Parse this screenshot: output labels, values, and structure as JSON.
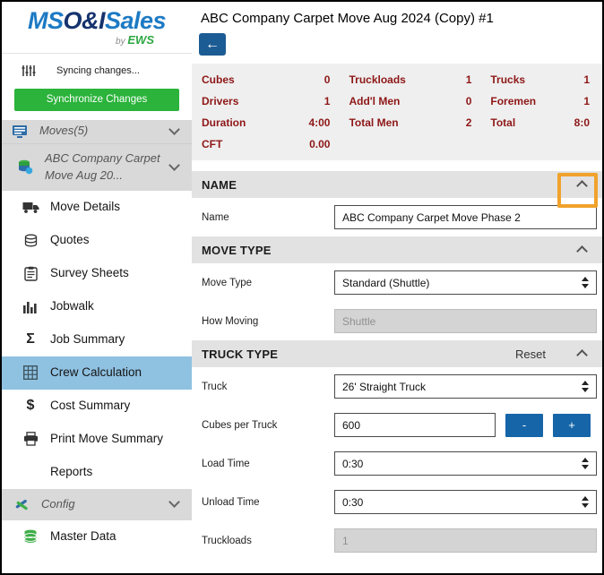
{
  "header": {
    "title": "ABC Company Carpet Move Aug 2024 (Copy) #1"
  },
  "sidebar": {
    "logo": {
      "ms": "MS",
      "oi": "O&I",
      "sales": "Sales",
      "by": "by",
      "ews": "EWS"
    },
    "sync_status": "Syncing changes...",
    "sync_button_label": "Synchronize Changes",
    "items": [
      {
        "label": "Moves(5)",
        "icon": "monitor-icon",
        "style": "group",
        "chevron": "down"
      },
      {
        "label": "ABC Company Carpet Move Aug 20...",
        "icon": "database-icon",
        "style": "subgroup",
        "chevron": "down"
      },
      {
        "label": "Move Details",
        "icon": "truck-icon"
      },
      {
        "label": "Quotes",
        "icon": "coins-icon"
      },
      {
        "label": "Survey Sheets",
        "icon": "clipboard-icon"
      },
      {
        "label": "Jobwalk",
        "icon": "barchart-icon"
      },
      {
        "label": "Job Summary",
        "icon": "sigma-icon"
      },
      {
        "label": "Crew Calculation",
        "icon": "calculator-icon",
        "selected": true
      },
      {
        "label": "Cost Summary",
        "icon": "dollar-icon"
      },
      {
        "label": "Print Move Summary",
        "icon": "printer-icon"
      },
      {
        "label": "Reports",
        "icon": "none"
      },
      {
        "label": "Config",
        "icon": "tools-icon",
        "style": "group-config",
        "chevron": "down"
      },
      {
        "label": "Master Data",
        "icon": "masterdata-icon"
      }
    ]
  },
  "summary": {
    "cells": [
      {
        "label": "Cubes",
        "value": "0"
      },
      {
        "label": "Truckloads",
        "value": "1"
      },
      {
        "label": "Trucks",
        "value": "1"
      },
      {
        "label": "Drivers",
        "value": "1"
      },
      {
        "label": "Add'l Men",
        "value": "0"
      },
      {
        "label": "Foremen",
        "value": "1"
      },
      {
        "label": "Duration",
        "value": "4:00"
      },
      {
        "label": "Total Men",
        "value": "2"
      },
      {
        "label": "Total",
        "value": "8:0"
      },
      {
        "label": "CFT",
        "value": "0.00"
      }
    ]
  },
  "form": {
    "name_section": {
      "title": "NAME"
    },
    "name_field": {
      "label": "Name",
      "value": "ABC Company Carpet Move Phase 2"
    },
    "move_type_section": {
      "title": "MOVE TYPE"
    },
    "move_type_field": {
      "label": "Move Type",
      "value": "Standard (Shuttle)"
    },
    "how_moving_field": {
      "label": "How Moving",
      "value": "Shuttle"
    },
    "truck_type_section": {
      "title": "TRUCK TYPE",
      "reset_label": "Reset"
    },
    "truck_field": {
      "label": "Truck",
      "value": "26' Straight Truck"
    },
    "cubes_per_truck_field": {
      "label": "Cubes per Truck",
      "value": "600",
      "minus_label": "-",
      "plus_label": "+"
    },
    "load_time_field": {
      "label": "Load Time",
      "value": "0:30"
    },
    "unload_time_field": {
      "label": "Unload Time",
      "value": "0:30"
    },
    "truckloads_field": {
      "label": "Truckloads",
      "value": "1"
    }
  },
  "colors": {
    "accent_green": "#2bb33b",
    "accent_blue": "#1c5c94",
    "step_button_blue": "#1665a8",
    "selected_item_blue": "#8fc1e1",
    "summary_value_maroon": "#8e1717",
    "annotation_orange": "#f0a22c"
  }
}
